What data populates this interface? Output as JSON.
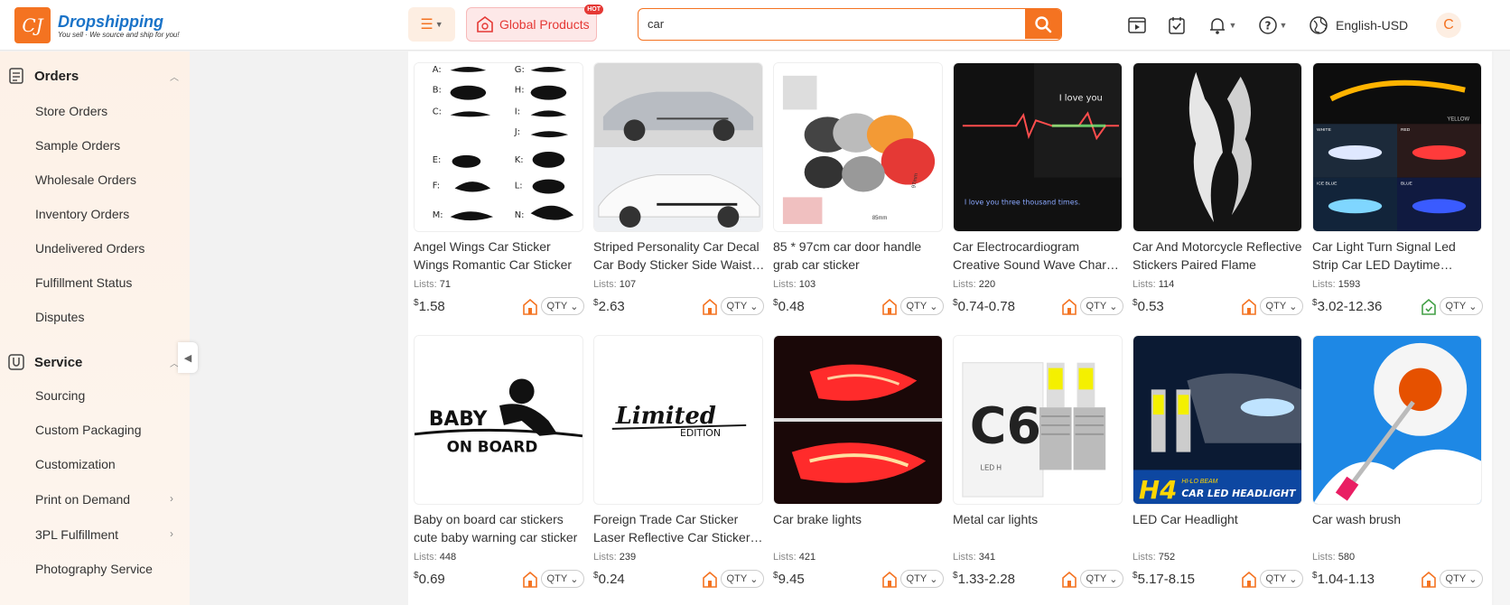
{
  "header": {
    "logo_title": "Dropshipping",
    "logo_sub": "You sell · We source and ship for you!",
    "logo_mark": "CJ",
    "global_label": "Global Products",
    "hot_badge": "HOT",
    "search_value": "car",
    "language": "English-USD",
    "avatar_letter": "C"
  },
  "sidebar": {
    "orders_title": "Orders",
    "orders_items": [
      "Store Orders",
      "Sample Orders",
      "Wholesale Orders",
      "Inventory Orders",
      "Undelivered Orders",
      "Fulfillment Status",
      "Disputes"
    ],
    "service_title": "Service",
    "service_items": [
      "Sourcing",
      "Custom Packaging",
      "Customization",
      "Print on Demand",
      "3PL Fulfillment",
      "Photography Service"
    ]
  },
  "colors": {
    "accent": "#f47321",
    "brand_blue": "#1a73c8",
    "hot": "#e53935"
  },
  "products": [
    {
      "title": "Angel Wings Car Sticker Wings Romantic Car Sticker",
      "lists_label": "Lists:",
      "lists": "71",
      "currency": "$",
      "price": "1.58",
      "qty": "QTY",
      "ship_icon": "warehouse-orange-icon"
    },
    {
      "title": "Striped Personality Car Decal Car Body Sticker Side Waist Decoration",
      "lists_label": "Lists:",
      "lists": "107",
      "currency": "$",
      "price": "2.63",
      "qty": "QTY",
      "ship_icon": "warehouse-orange-icon"
    },
    {
      "title": "85 * 97cm car door handle grab car sticker",
      "lists_label": "Lists:",
      "lists": "103",
      "currency": "$",
      "price": "0.48",
      "qty": "QTY",
      "ship_icon": "warehouse-orange-icon"
    },
    {
      "title": "Car Electrocardiogram Creative Sound Wave Charm Light",
      "lists_label": "Lists:",
      "lists": "220",
      "currency": "$",
      "price": "0.74-0.78",
      "qty": "QTY",
      "ship_icon": "warehouse-orange-icon"
    },
    {
      "title": "Car And Motorcycle Reflective Stickers Paired Flame",
      "lists_label": "Lists:",
      "lists": "114",
      "currency": "$",
      "price": "0.53",
      "qty": "QTY",
      "ship_icon": "warehouse-orange-icon"
    },
    {
      "title": "Car Light Turn Signal Led Strip Car LED Daytime Running Light",
      "lists_label": "Lists:",
      "lists": "1593",
      "currency": "$",
      "price": "3.02-12.36",
      "qty": "QTY",
      "ship_icon": "warehouse-green-icon"
    },
    {
      "title": "Baby on board car stickers cute baby warning car sticker",
      "lists_label": "Lists:",
      "lists": "448",
      "currency": "$",
      "price": "0.69",
      "qty": "QTY",
      "ship_icon": "warehouse-orange-icon"
    },
    {
      "title": "Foreign Trade Car Sticker Laser Reflective Car Sticker Limited Edition",
      "lists_label": "Lists:",
      "lists": "239",
      "currency": "$",
      "price": "0.24",
      "qty": "QTY",
      "ship_icon": "warehouse-orange-icon"
    },
    {
      "title": "Car brake lights",
      "lists_label": "Lists:",
      "lists": "421",
      "currency": "$",
      "price": "9.45",
      "qty": "QTY",
      "ship_icon": "warehouse-orange-icon"
    },
    {
      "title": "Metal car lights",
      "lists_label": "Lists:",
      "lists": "341",
      "currency": "$",
      "price": "1.33-2.28",
      "qty": "QTY",
      "ship_icon": "warehouse-orange-icon"
    },
    {
      "title": "LED Car Headlight",
      "lists_label": "Lists:",
      "lists": "752",
      "currency": "$",
      "price": "5.17-8.15",
      "qty": "QTY",
      "ship_icon": "warehouse-orange-icon"
    },
    {
      "title": "Car wash brush",
      "lists_label": "Lists:",
      "lists": "580",
      "currency": "$",
      "price": "1.04-1.13",
      "qty": "QTY",
      "ship_icon": "warehouse-orange-icon"
    }
  ],
  "image_text": {
    "wing_letters": [
      "A:",
      "B:",
      "C:",
      "E:",
      "F:",
      "M:",
      "G:",
      "H:",
      "I:",
      "J:",
      "K:",
      "L:",
      "N:"
    ],
    "love_text": "I love you",
    "love_caption": "I love you three thousand times.",
    "door_dim_h": "97mm",
    "door_dim_w": "85mm",
    "headlight_tag": "YELLOW",
    "headlight_white": "WHITE",
    "headlight_red": "RED",
    "headlight_ice": "ICE BLUE",
    "headlight_blue": "BLUE",
    "baby_line1": "BABY",
    "baby_line2": "ON BOARD",
    "limited_line1": "Limited",
    "limited_line2": "EDITION",
    "c6_text": "C6",
    "c6_sub": "LED H",
    "h4_model": "H4",
    "h4_beam": "HI-LO BEAM",
    "h4_tagline": "CAR LED HEADLIGHT"
  }
}
